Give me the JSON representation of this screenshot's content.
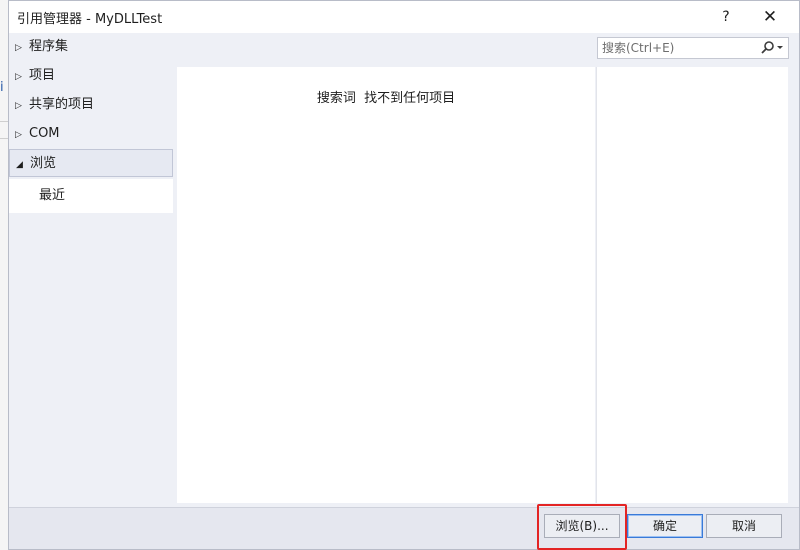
{
  "background": {
    "glyph": "i"
  },
  "window": {
    "title": "引用管理器 - MyDLLTest",
    "help_label": "?",
    "close_label": "✕"
  },
  "nav": {
    "items": [
      {
        "label": "程序集",
        "expanded": false
      },
      {
        "label": "项目",
        "expanded": false
      },
      {
        "label": "共享的项目",
        "expanded": false
      },
      {
        "label": "COM",
        "expanded": false
      },
      {
        "label": "浏览",
        "expanded": true,
        "selected": true
      }
    ],
    "sub_items": [
      {
        "label": "最近"
      }
    ]
  },
  "search": {
    "placeholder": "搜索(Ctrl+E)",
    "value": "",
    "icon": "search-icon"
  },
  "list": {
    "empty_message": "搜索词  找不到任何项目"
  },
  "buttons": {
    "browse": "浏览(B)...",
    "ok": "确定",
    "cancel": "取消"
  },
  "colors": {
    "highlight": "#e32424",
    "accent": "#3a7ad8"
  }
}
